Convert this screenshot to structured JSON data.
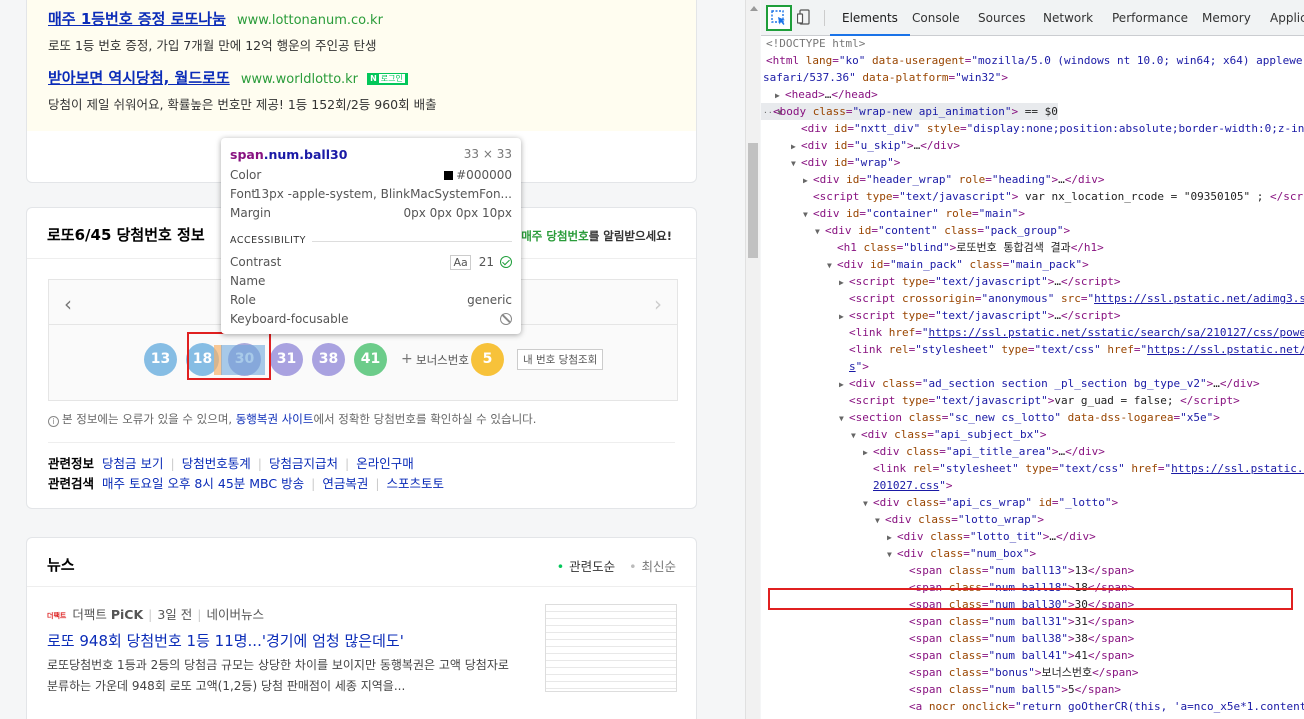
{
  "ads": [
    {
      "title": "매주 1등번호 증정 로또나눔",
      "url": "www.lottonanum.co.kr",
      "badge": "",
      "desc": "로또 1등 번호 증정, 가입 7개월 만에 12억 행운의 주인공 탄생"
    },
    {
      "title": "받아보면 역시당첨, 월드로또",
      "url": "www.worldlotto.kr",
      "badge": "N",
      "badge_sub": "로그인",
      "desc": "당첨이 제일 쉬워어요, 확률높은 번호만 제공! 1등 152회/2등 960회 배출"
    }
  ],
  "lotto": {
    "heading": "로또6/45 당첨번호 정보",
    "alert_green": "매주 당첨번호",
    "alert_rest": "를 알림받으세요!",
    "balls": [
      {
        "num": "13",
        "color": "#86bde4"
      },
      {
        "num": "18",
        "color": "#86bde4"
      },
      {
        "num": "30",
        "color": "#8f8fd0"
      },
      {
        "num": "31",
        "color": "#a9a2e0"
      },
      {
        "num": "38",
        "color": "#a9a2e0"
      },
      {
        "num": "41",
        "color": "#6ccc8a"
      }
    ],
    "plus": "+",
    "bonus_label": "보너스번호",
    "bonus": {
      "num": "5",
      "color": "#f7c23a"
    },
    "mynum_button": "내 번호 당첨조회",
    "notice_pre": "본 정보에는 오류가 있을 수 있으며, ",
    "notice_link": "동행복권 사이트",
    "notice_post": "에서 정확한 당첨번호를 확인하실 수 있습니다.",
    "related_info_label": "관련정보",
    "related_info": [
      "당첨금 보기",
      "당첨번호통계",
      "당첨금지급처",
      "온라인구매"
    ],
    "related_search_label": "관련검색",
    "related_search": [
      "매주 토요일 오후 8시 45분 MBC 방송",
      "연금복권",
      "스포츠토토"
    ]
  },
  "news": {
    "heading": "뉴스",
    "sort_active": "관련도순",
    "sort_inactive": "최신순",
    "source_logo": "더팩트",
    "source": "더팩트",
    "pick": "PiCK",
    "time": "3일 전",
    "portal": "네이버뉴스",
    "title": "로또 948회 당첨번호 1등 11명...'경기에 엄청 많은데도'",
    "desc": "로또당첨번호 1등과 2등의 당첨금 규모는 상당한 차이를 보이지만 동행복권은 고액 당첨자로 분류하는 가운데 948회 로또 고액(1,2등) 당첨 판매점이 세종 지역을..."
  },
  "tooltip": {
    "tag": "span",
    "classes": ".num.ball30",
    "size": "33 × 33",
    "color_label": "Color",
    "color_value": "#000000",
    "font_label": "Font",
    "font_value": "13px -apple-system, BlinkMacSystemFon...",
    "margin_label": "Margin",
    "margin_value": "0px 0px 0px 10px",
    "section": "ACCESSIBILITY",
    "contrast_label": "Contrast",
    "contrast_aa": "Aa",
    "contrast_value": "21",
    "name_label": "Name",
    "role_label": "Role",
    "role_value": "generic",
    "keyboard_label": "Keyboard-focusable"
  },
  "devtools": {
    "tabs": [
      "Elements",
      "Console",
      "Sources",
      "Network",
      "Performance",
      "Memory",
      "Applic"
    ],
    "active_tab": "Elements"
  },
  "dom_lines": [
    {
      "indent": 3,
      "tri": "",
      "html": "<span class='cm'>&lt;!DOCTYPE html&gt;</span>"
    },
    {
      "indent": 3,
      "tri": "",
      "html": "<span class='t'>&lt;html</span> <span class='a'>lang</span>=<span class='v'>\"ko\"</span> <span class='a'>data-useragent</span>=<span class='v'>\"mozilla/5.0 (windows nt 10.0; win64; x64) applewe</span>"
    },
    {
      "indent": 0,
      "tri": "",
      "html": "<span class='v'>safari/537.36\"</span> <span class='a'>data-platform</span>=<span class='v'>\"win32\"</span><span class='t'>&gt;</span>"
    },
    {
      "indent": 12,
      "tri": "▶",
      "html": "<span class='t'>&lt;head&gt;</span><span class='tx'>…</span><span class='t'>&lt;/head&gt;</span>"
    },
    {
      "indent": 0,
      "tri": "···▼",
      "html": "<span class='t'>&lt;body</span> <span class='a'>class</span>=<span class='v'>\"wrap-new api_animation\"</span><span class='t'>&gt;</span> <span class='tx'>== $0</span>"
    },
    {
      "indent": 38,
      "tri": "",
      "html": "<span class='t'>&lt;div</span> <span class='a'>id</span>=<span class='v'>\"nxtt_div\"</span> <span class='a'>style</span>=<span class='v'>\"display:none;position:absolute;border-width:0;z-ind</span>"
    },
    {
      "indent": 28,
      "tri": "▶",
      "html": "<span class='t'>&lt;div</span> <span class='a'>id</span>=<span class='v'>\"u_skip\"</span><span class='t'>&gt;</span><span class='tx'>…</span><span class='t'>&lt;/div&gt;</span>"
    },
    {
      "indent": 28,
      "tri": "▼",
      "html": "<span class='t'>&lt;div</span> <span class='a'>id</span>=<span class='v'>\"wrap\"</span><span class='t'>&gt;</span>"
    },
    {
      "indent": 40,
      "tri": "▶",
      "html": "<span class='t'>&lt;div</span> <span class='a'>id</span>=<span class='v'>\"header_wrap\"</span> <span class='a'>role</span>=<span class='v'>\"heading\"</span><span class='t'>&gt;</span><span class='tx'>…</span><span class='t'>&lt;/div&gt;</span>"
    },
    {
      "indent": 50,
      "tri": "",
      "html": "<span class='t'>&lt;script</span> <span class='a'>type</span>=<span class='v'>\"text/javascript\"</span><span class='t'>&gt;</span><span class='tx'> var nx_location_rcode = \"09350105\" ; </span><span class='t'>&lt;/scri</span>"
    },
    {
      "indent": 40,
      "tri": "▼",
      "html": "<span class='t'>&lt;div</span> <span class='a'>id</span>=<span class='v'>\"container\"</span> <span class='a'>role</span>=<span class='v'>\"main\"</span><span class='t'>&gt;</span>"
    },
    {
      "indent": 52,
      "tri": "▼",
      "html": "<span class='t'>&lt;div</span> <span class='a'>id</span>=<span class='v'>\"content\"</span> <span class='a'>class</span>=<span class='v'>\"pack_group\"</span><span class='t'>&gt;</span>"
    },
    {
      "indent": 74,
      "tri": "",
      "html": "<span class='t'>&lt;h1</span> <span class='a'>class</span>=<span class='v'>\"blind\"</span><span class='t'>&gt;</span><span class='tx'>로또번호 통합검색 결과</span><span class='t'>&lt;/h1&gt;</span>"
    },
    {
      "indent": 64,
      "tri": "▼",
      "html": "<span class='t'>&lt;div</span> <span class='a'>id</span>=<span class='v'>\"main_pack\"</span> <span class='a'>class</span>=<span class='v'>\"main_pack\"</span><span class='t'>&gt;</span>"
    },
    {
      "indent": 76,
      "tri": "▶",
      "html": "<span class='t'>&lt;script</span> <span class='a'>type</span>=<span class='v'>\"text/javascript\"</span><span class='t'>&gt;</span><span class='tx'>…</span><span class='t'>&lt;/script&gt;</span>"
    },
    {
      "indent": 86,
      "tri": "",
      "html": "<span class='t'>&lt;script</span> <span class='a'>crossorigin</span>=<span class='v'>\"anonymous\"</span> <span class='a'>src</span>=<span class='v'>\"</span><span class='ln'>https://ssl.pstatic.net/adimg3.se</span>"
    },
    {
      "indent": 76,
      "tri": "▶",
      "html": "<span class='t'>&lt;script</span> <span class='a'>type</span>=<span class='v'>\"text/javascript\"</span><span class='t'>&gt;</span><span class='tx'>…</span><span class='t'>&lt;/script&gt;</span>"
    },
    {
      "indent": 86,
      "tri": "",
      "html": "<span class='t'>&lt;link</span> <span class='a'>href</span>=<span class='v'>\"</span><span class='ln'>https://ssl.pstatic.net/sstatic/search/sa/210127/css/powe</span>"
    },
    {
      "indent": 86,
      "tri": "",
      "html": "<span class='t'>&lt;link</span> <span class='a'>rel</span>=<span class='v'>\"stylesheet\"</span> <span class='a'>type</span>=<span class='v'>\"text/css\"</span> <span class='a'>href</span>=<span class='v'>\"</span><span class='ln'>https://ssl.pstatic.net/s</span>"
    },
    {
      "indent": 86,
      "tri": "",
      "html": "<span class='ln'>s</span><span class='v'>\"</span><span class='t'>&gt;</span>"
    },
    {
      "indent": 76,
      "tri": "▶",
      "html": "<span class='t'>&lt;div</span> <span class='a'>class</span>=<span class='v'>\"ad_section section _pl_section bg_type_v2\"</span><span class='t'>&gt;</span><span class='tx'>…</span><span class='t'>&lt;/div&gt;</span>"
    },
    {
      "indent": 86,
      "tri": "",
      "html": "<span class='t'>&lt;script</span> <span class='a'>type</span>=<span class='v'>\"text/javascript\"</span><span class='t'>&gt;</span><span class='tx'>var g_uad = false; </span><span class='t'>&lt;/script&gt;</span>"
    },
    {
      "indent": 76,
      "tri": "▼",
      "html": "<span class='t'>&lt;section</span> <span class='a'>class</span>=<span class='v'>\"sc_new cs_lotto\"</span> <span class='a'>data-dss-logarea</span>=<span class='v'>\"x5e\"</span><span class='t'>&gt;</span>"
    },
    {
      "indent": 88,
      "tri": "▼",
      "html": "<span class='t'>&lt;div</span> <span class='a'>class</span>=<span class='v'>\"api_subject_bx\"</span><span class='t'>&gt;</span>"
    },
    {
      "indent": 100,
      "tri": "▶",
      "html": "<span class='t'>&lt;div</span> <span class='a'>class</span>=<span class='v'>\"api_title_area\"</span><span class='t'>&gt;</span><span class='tx'>…</span><span class='t'>&lt;/div&gt;</span>"
    },
    {
      "indent": 110,
      "tri": "",
      "html": "<span class='t'>&lt;link</span> <span class='a'>rel</span>=<span class='v'>\"stylesheet\"</span> <span class='a'>type</span>=<span class='v'>\"text/css\"</span> <span class='a'>href</span>=<span class='v'>\"</span><span class='ln'>https://ssl.pstatic.n</span>"
    },
    {
      "indent": 110,
      "tri": "",
      "html": "<span class='ln'>201027.css</span><span class='v'>\"</span><span class='t'>&gt;</span>"
    },
    {
      "indent": 100,
      "tri": "▼",
      "html": "<span class='t'>&lt;div</span> <span class='a'>class</span>=<span class='v'>\"api_cs_wrap\"</span> <span class='a'>id</span>=<span class='v'>\"_lotto\"</span><span class='t'>&gt;</span>"
    },
    {
      "indent": 112,
      "tri": "▼",
      "html": "<span class='t'>&lt;div</span> <span class='a'>class</span>=<span class='v'>\"lotto_wrap\"</span><span class='t'>&gt;</span>"
    },
    {
      "indent": 124,
      "tri": "▶",
      "html": "<span class='t'>&lt;div</span> <span class='a'>class</span>=<span class='v'>\"lotto_tit\"</span><span class='t'>&gt;</span><span class='tx'>…</span><span class='t'>&lt;/div&gt;</span>"
    },
    {
      "indent": 124,
      "tri": "▼",
      "html": "<span class='t'>&lt;div</span> <span class='a'>class</span>=<span class='v'>\"num_box\"</span><span class='t'>&gt;</span>"
    },
    {
      "indent": 146,
      "tri": "",
      "html": "<span class='t'>&lt;span</span> <span class='a'>class</span>=<span class='v'>\"num ball13\"</span><span class='t'>&gt;</span><span class='tx'>13</span><span class='t'>&lt;/span&gt;</span>"
    },
    {
      "indent": 146,
      "tri": "",
      "html": "<span class='t'>&lt;span</span> <span class='a'>class</span>=<span class='v'>\"num ball18\"</span><span class='t'>&gt;</span><span class='tx'>18</span><span class='t'>&lt;/span&gt;</span>"
    },
    {
      "indent": 146,
      "tri": "",
      "html": "<span class='t'>&lt;span</span> <span class='a'>class</span>=<span class='v'>\"num ball30\"</span><span class='t'>&gt;</span><span class='tx'>30</span><span class='t'>&lt;/span&gt;</span>"
    },
    {
      "indent": 146,
      "tri": "",
      "html": "<span class='t'>&lt;span</span> <span class='a'>class</span>=<span class='v'>\"num ball31\"</span><span class='t'>&gt;</span><span class='tx'>31</span><span class='t'>&lt;/span&gt;</span>"
    },
    {
      "indent": 146,
      "tri": "",
      "html": "<span class='t'>&lt;span</span> <span class='a'>class</span>=<span class='v'>\"num ball38\"</span><span class='t'>&gt;</span><span class='tx'>38</span><span class='t'>&lt;/span&gt;</span>"
    },
    {
      "indent": 146,
      "tri": "",
      "html": "<span class='t'>&lt;span</span> <span class='a'>class</span>=<span class='v'>\"num ball41\"</span><span class='t'>&gt;</span><span class='tx'>41</span><span class='t'>&lt;/span&gt;</span>"
    },
    {
      "indent": 146,
      "tri": "",
      "html": "<span class='t'>&lt;span</span> <span class='a'>class</span>=<span class='v'>\"bonus\"</span><span class='t'>&gt;</span><span class='tx'>보너스번호</span><span class='t'>&lt;/span&gt;</span>"
    },
    {
      "indent": 146,
      "tri": "",
      "html": "<span class='t'>&lt;span</span> <span class='a'>class</span>=<span class='v'>\"num ball5\"</span><span class='t'>&gt;</span><span class='tx'>5</span><span class='t'>&lt;/span&gt;</span>"
    },
    {
      "indent": 146,
      "tri": "",
      "html": "<span class='t'>&lt;a</span> <span class='a'>nocr</span> <span class='a'>onclick</span>=<span class='v'>\"return goOtherCR(this, 'a=nco_x5e*1.content</span>"
    }
  ]
}
